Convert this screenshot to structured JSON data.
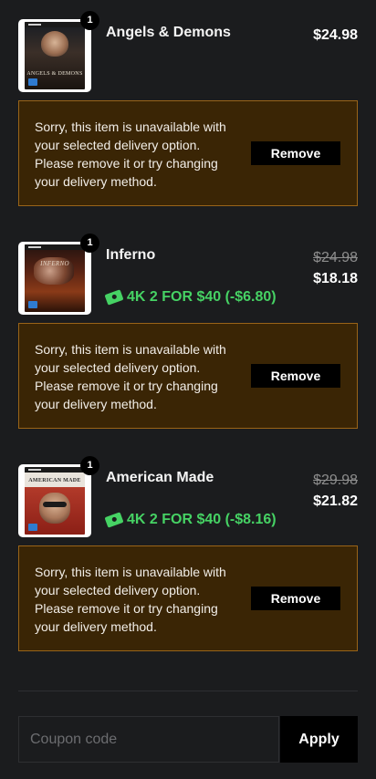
{
  "items": [
    {
      "title": "Angels & Demons",
      "quantity": "1",
      "cover_caption": "ANGELS & DEMONS",
      "old_price": "",
      "price": "$24.98",
      "promo": "",
      "notice": "Sorry, this item is unavailable with your selected delivery option. Please remove it or try changing your delivery method.",
      "remove_label": "Remove"
    },
    {
      "title": "Inferno",
      "quantity": "1",
      "cover_caption": "INFERNO",
      "old_price": "$24.98",
      "price": "$18.18",
      "promo": "4K 2 FOR $40 (-$6.80)",
      "promo_icon": "ticket-icon",
      "notice": "Sorry, this item is unavailable with your selected delivery option. Please remove it or try changing your delivery method.",
      "remove_label": "Remove"
    },
    {
      "title": "American Made",
      "quantity": "1",
      "cover_caption": "AMERICAN MADE",
      "old_price": "$29.98",
      "price": "$21.82",
      "promo": "4K 2 FOR $40 (-$8.16)",
      "promo_icon": "ticket-icon",
      "notice": "Sorry, this item is unavailable with your selected delivery option. Please remove it or try changing your delivery method.",
      "remove_label": "Remove"
    }
  ],
  "coupon": {
    "placeholder": "Coupon code",
    "value": "",
    "apply_label": "Apply"
  },
  "colors": {
    "background": "#1b1c1e",
    "notice_background": "#3a2505",
    "notice_border": "#9a6418",
    "promo_green": "#46d264",
    "button_black": "#000000"
  }
}
